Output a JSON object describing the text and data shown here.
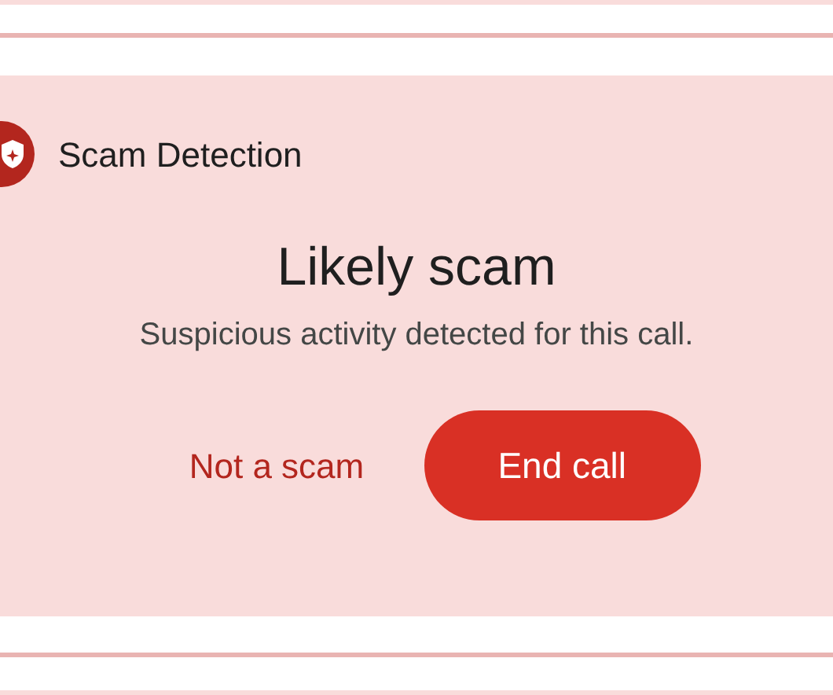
{
  "card": {
    "header": "Scam Detection",
    "title": "Likely scam",
    "message": "Suspicious activity detected for this call.",
    "buttons": [
      {
        "label": "Not a scam",
        "kind": "text"
      },
      {
        "label": "End call",
        "kind": "filled"
      }
    ]
  }
}
